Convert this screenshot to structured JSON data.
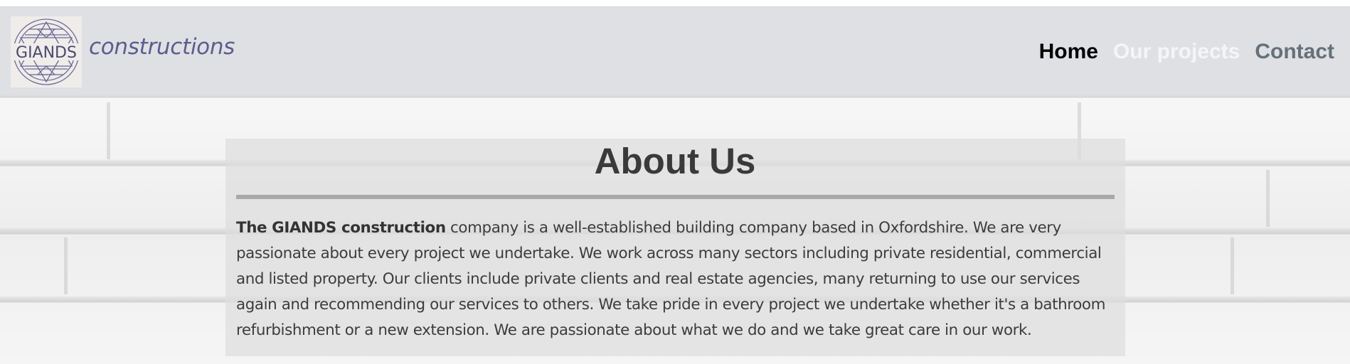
{
  "header": {
    "logo_text": "GIANDS",
    "brand": "constructions"
  },
  "nav": {
    "items": [
      {
        "label": "Home"
      },
      {
        "label": "Our projects"
      },
      {
        "label": "Contact"
      }
    ]
  },
  "about": {
    "title": "About Us",
    "lead": "The GIANDS construction",
    "text": " company is a well-established building company based in Oxfordshire. We are very passionate about every project we undertake. We work across many sectors including private residential, commercial and listed property. Our clients include private clients and real estate agencies, many returning to use our services again and recommending our services to others. We take pride in every project we undertake whether it's a bathroom refurbishment or a new extension. We are passionate about what we do and we take great care in our work."
  },
  "colors": {
    "navbar_bg": "#dee0e4",
    "brand": "#5d5d8c",
    "nav_home": "#000000",
    "nav_projects": "#f4f5f7",
    "nav_contact": "#65707a",
    "title": "#3a3a3a"
  }
}
